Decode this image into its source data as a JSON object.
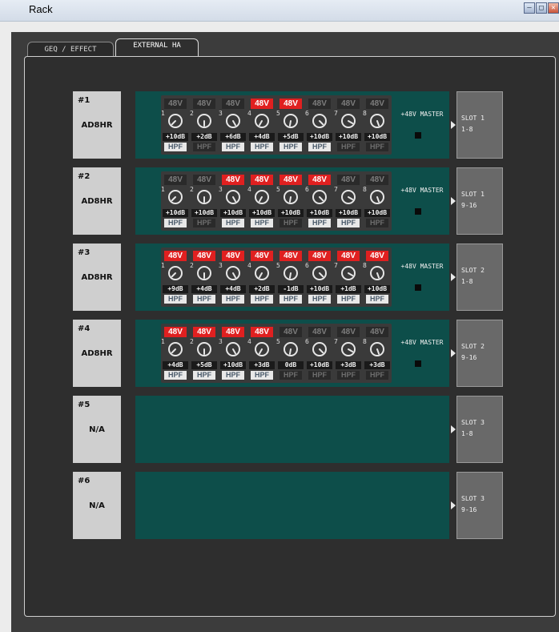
{
  "window": {
    "title": "Rack"
  },
  "window_buttons": [
    "minimize",
    "maximize",
    "close"
  ],
  "tabs": [
    {
      "label": "GEQ / EFFECT",
      "active": false
    },
    {
      "label": "EXTERNAL HA",
      "active": true
    }
  ],
  "colors": {
    "phantom_on": "#e02020",
    "ha_background": "#0d4e4a",
    "panel_background": "#2e2e2e"
  },
  "units": [
    {
      "number": "#1",
      "model": "AD8HR",
      "master_label": "+48V MASTER",
      "slot": {
        "name": "SLOT 1",
        "range": "1-8"
      },
      "channels": [
        {
          "ch": "1",
          "phantom_label": "48V",
          "phantom_on": false,
          "gain": "+10dB",
          "hpf_label": "HPF",
          "hpf_on": true
        },
        {
          "ch": "2",
          "phantom_label": "48V",
          "phantom_on": false,
          "gain": "+2dB",
          "hpf_label": "HPF",
          "hpf_on": false
        },
        {
          "ch": "3",
          "phantom_label": "48V",
          "phantom_on": false,
          "gain": "+6dB",
          "hpf_label": "HPF",
          "hpf_on": true
        },
        {
          "ch": "4",
          "phantom_label": "48V",
          "phantom_on": true,
          "gain": "+4dB",
          "hpf_label": "HPF",
          "hpf_on": true
        },
        {
          "ch": "5",
          "phantom_label": "48V",
          "phantom_on": true,
          "gain": "+5dB",
          "hpf_label": "HPF",
          "hpf_on": true
        },
        {
          "ch": "6",
          "phantom_label": "48V",
          "phantom_on": false,
          "gain": "+10dB",
          "hpf_label": "HPF",
          "hpf_on": true
        },
        {
          "ch": "7",
          "phantom_label": "48V",
          "phantom_on": false,
          "gain": "+10dB",
          "hpf_label": "HPF",
          "hpf_on": false
        },
        {
          "ch": "8",
          "phantom_label": "48V",
          "phantom_on": false,
          "gain": "+10dB",
          "hpf_label": "HPF",
          "hpf_on": false
        }
      ]
    },
    {
      "number": "#2",
      "model": "AD8HR",
      "master_label": "+48V MASTER",
      "slot": {
        "name": "SLOT 1",
        "range": "9-16"
      },
      "channels": [
        {
          "ch": "1",
          "phantom_label": "48V",
          "phantom_on": false,
          "gain": "+10dB",
          "hpf_label": "HPF",
          "hpf_on": true
        },
        {
          "ch": "2",
          "phantom_label": "48V",
          "phantom_on": false,
          "gain": "+10dB",
          "hpf_label": "HPF",
          "hpf_on": false
        },
        {
          "ch": "3",
          "phantom_label": "48V",
          "phantom_on": true,
          "gain": "+10dB",
          "hpf_label": "HPF",
          "hpf_on": true
        },
        {
          "ch": "4",
          "phantom_label": "48V",
          "phantom_on": true,
          "gain": "+10dB",
          "hpf_label": "HPF",
          "hpf_on": true
        },
        {
          "ch": "5",
          "phantom_label": "48V",
          "phantom_on": true,
          "gain": "+10dB",
          "hpf_label": "HPF",
          "hpf_on": false
        },
        {
          "ch": "6",
          "phantom_label": "48V",
          "phantom_on": true,
          "gain": "+10dB",
          "hpf_label": "HPF",
          "hpf_on": true
        },
        {
          "ch": "7",
          "phantom_label": "48V",
          "phantom_on": false,
          "gain": "+10dB",
          "hpf_label": "HPF",
          "hpf_on": true
        },
        {
          "ch": "8",
          "phantom_label": "48V",
          "phantom_on": false,
          "gain": "+10dB",
          "hpf_label": "HPF",
          "hpf_on": false
        }
      ]
    },
    {
      "number": "#3",
      "model": "AD8HR",
      "master_label": "+48V MASTER",
      "slot": {
        "name": "SLOT 2",
        "range": "1-8"
      },
      "channels": [
        {
          "ch": "1",
          "phantom_label": "48V",
          "phantom_on": true,
          "gain": "+9dB",
          "hpf_label": "HPF",
          "hpf_on": true
        },
        {
          "ch": "2",
          "phantom_label": "48V",
          "phantom_on": true,
          "gain": "+4dB",
          "hpf_label": "HPF",
          "hpf_on": true
        },
        {
          "ch": "3",
          "phantom_label": "48V",
          "phantom_on": true,
          "gain": "+4dB",
          "hpf_label": "HPF",
          "hpf_on": true
        },
        {
          "ch": "4",
          "phantom_label": "48V",
          "phantom_on": true,
          "gain": "+2dB",
          "hpf_label": "HPF",
          "hpf_on": true
        },
        {
          "ch": "5",
          "phantom_label": "48V",
          "phantom_on": true,
          "gain": "-1dB",
          "hpf_label": "HPF",
          "hpf_on": true
        },
        {
          "ch": "6",
          "phantom_label": "48V",
          "phantom_on": true,
          "gain": "+10dB",
          "hpf_label": "HPF",
          "hpf_on": true
        },
        {
          "ch": "7",
          "phantom_label": "48V",
          "phantom_on": true,
          "gain": "+1dB",
          "hpf_label": "HPF",
          "hpf_on": true
        },
        {
          "ch": "8",
          "phantom_label": "48V",
          "phantom_on": true,
          "gain": "+10dB",
          "hpf_label": "HPF",
          "hpf_on": true
        }
      ]
    },
    {
      "number": "#4",
      "model": "AD8HR",
      "master_label": "+48V MASTER",
      "slot": {
        "name": "SLOT 2",
        "range": "9-16"
      },
      "channels": [
        {
          "ch": "1",
          "phantom_label": "48V",
          "phantom_on": true,
          "gain": "+4dB",
          "hpf_label": "HPF",
          "hpf_on": true
        },
        {
          "ch": "2",
          "phantom_label": "48V",
          "phantom_on": true,
          "gain": "+5dB",
          "hpf_label": "HPF",
          "hpf_on": true
        },
        {
          "ch": "3",
          "phantom_label": "48V",
          "phantom_on": true,
          "gain": "+10dB",
          "hpf_label": "HPF",
          "hpf_on": true
        },
        {
          "ch": "4",
          "phantom_label": "48V",
          "phantom_on": true,
          "gain": "+3dB",
          "hpf_label": "HPF",
          "hpf_on": true
        },
        {
          "ch": "5",
          "phantom_label": "48V",
          "phantom_on": false,
          "gain": "0dB",
          "hpf_label": "HPF",
          "hpf_on": false
        },
        {
          "ch": "6",
          "phantom_label": "48V",
          "phantom_on": false,
          "gain": "+10dB",
          "hpf_label": "HPF",
          "hpf_on": false
        },
        {
          "ch": "7",
          "phantom_label": "48V",
          "phantom_on": false,
          "gain": "+3dB",
          "hpf_label": "HPF",
          "hpf_on": false
        },
        {
          "ch": "8",
          "phantom_label": "48V",
          "phantom_on": false,
          "gain": "+3dB",
          "hpf_label": "HPF",
          "hpf_on": false
        }
      ]
    },
    {
      "number": "#5",
      "model": "N/A",
      "slot": {
        "name": "SLOT 3",
        "range": "1-8"
      },
      "channels": []
    },
    {
      "number": "#6",
      "model": "N/A",
      "slot": {
        "name": "SLOT 3",
        "range": "9-16"
      },
      "channels": []
    }
  ]
}
